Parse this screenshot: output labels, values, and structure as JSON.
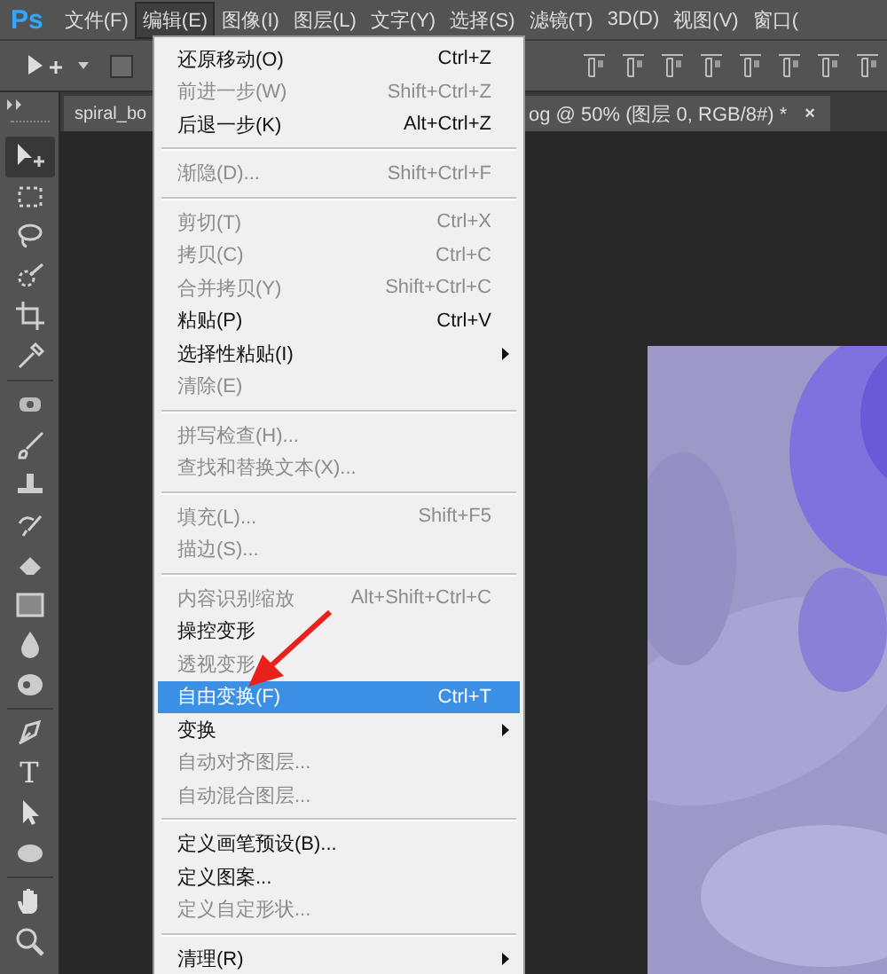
{
  "app_logo": "Ps",
  "menu_bar": [
    {
      "label": "文件(F)",
      "selected": false
    },
    {
      "label": "编辑(E)",
      "selected": true
    },
    {
      "label": "图像(I)",
      "selected": false
    },
    {
      "label": "图层(L)",
      "selected": false
    },
    {
      "label": "文字(Y)",
      "selected": false
    },
    {
      "label": "选择(S)",
      "selected": false
    },
    {
      "label": "滤镜(T)",
      "selected": false
    },
    {
      "label": "3D(D)",
      "selected": false
    },
    {
      "label": "视图(V)",
      "selected": false
    },
    {
      "label": "窗口(",
      "selected": false
    }
  ],
  "options_bar": {
    "auto_select_checked": false
  },
  "document_tab": {
    "title_start": "spiral_bo",
    "title_end": "og @ 50% (图层 0, RGB/8#) *",
    "close": "×"
  },
  "tools": [
    {
      "kind": "move",
      "selected": true
    },
    {
      "kind": "marquee",
      "selected": false
    },
    {
      "kind": "lasso",
      "selected": false
    },
    {
      "kind": "quick",
      "selected": false
    },
    {
      "kind": "crop",
      "selected": false
    },
    {
      "kind": "eyedropper",
      "selected": false,
      "group_end": true
    },
    {
      "kind": "healing",
      "selected": false
    },
    {
      "kind": "brush",
      "selected": false
    },
    {
      "kind": "stamp",
      "selected": false
    },
    {
      "kind": "history",
      "selected": false
    },
    {
      "kind": "eraser",
      "selected": false
    },
    {
      "kind": "gradient",
      "selected": false
    },
    {
      "kind": "blur",
      "selected": false
    },
    {
      "kind": "dodge",
      "selected": false,
      "group_end": true
    },
    {
      "kind": "pen",
      "selected": false
    },
    {
      "kind": "type",
      "glyph": "T",
      "selected": false
    },
    {
      "kind": "path",
      "selected": false
    },
    {
      "kind": "ellipse",
      "selected": false,
      "group_end": true
    },
    {
      "kind": "hand",
      "selected": false
    },
    {
      "kind": "zoom",
      "selected": false
    }
  ],
  "edit_menu": [
    {
      "kind": "item",
      "label": "还原移动(O)",
      "shortcut": "Ctrl+Z",
      "disabled": false,
      "submenu": false,
      "selected": false
    },
    {
      "kind": "item",
      "label": "前进一步(W)",
      "shortcut": "Shift+Ctrl+Z",
      "disabled": true,
      "submenu": false,
      "selected": false
    },
    {
      "kind": "item",
      "label": "后退一步(K)",
      "shortcut": "Alt+Ctrl+Z",
      "disabled": false,
      "submenu": false,
      "selected": false
    },
    {
      "kind": "separator"
    },
    {
      "kind": "item",
      "label": "渐隐(D)...",
      "shortcut": "Shift+Ctrl+F",
      "disabled": true,
      "submenu": false,
      "selected": false
    },
    {
      "kind": "separator"
    },
    {
      "kind": "item",
      "label": "剪切(T)",
      "shortcut": "Ctrl+X",
      "disabled": true,
      "submenu": false,
      "selected": false
    },
    {
      "kind": "item",
      "label": "拷贝(C)",
      "shortcut": "Ctrl+C",
      "disabled": true,
      "submenu": false,
      "selected": false
    },
    {
      "kind": "item",
      "label": "合并拷贝(Y)",
      "shortcut": "Shift+Ctrl+C",
      "disabled": true,
      "submenu": false,
      "selected": false
    },
    {
      "kind": "item",
      "label": "粘贴(P)",
      "shortcut": "Ctrl+V",
      "disabled": false,
      "submenu": false,
      "selected": false
    },
    {
      "kind": "item",
      "label": "选择性粘贴(I)",
      "disabled": false,
      "submenu": true,
      "selected": false
    },
    {
      "kind": "item",
      "label": "清除(E)",
      "disabled": true,
      "submenu": false,
      "selected": false
    },
    {
      "kind": "separator"
    },
    {
      "kind": "item",
      "label": "拼写检查(H)...",
      "disabled": true,
      "submenu": false,
      "selected": false
    },
    {
      "kind": "item",
      "label": "查找和替换文本(X)...",
      "disabled": true,
      "submenu": false,
      "selected": false
    },
    {
      "kind": "separator"
    },
    {
      "kind": "item",
      "label": "填充(L)...",
      "shortcut": "Shift+F5",
      "disabled": true,
      "submenu": false,
      "selected": false
    },
    {
      "kind": "item",
      "label": "描边(S)...",
      "disabled": true,
      "submenu": false,
      "selected": false
    },
    {
      "kind": "separator"
    },
    {
      "kind": "item",
      "label": "内容识别缩放",
      "shortcut": "Alt+Shift+Ctrl+C",
      "disabled": true,
      "submenu": false,
      "selected": false
    },
    {
      "kind": "item",
      "label": "操控变形",
      "disabled": false,
      "submenu": false,
      "selected": false
    },
    {
      "kind": "item",
      "label": "透视变形",
      "disabled": true,
      "submenu": false,
      "selected": false
    },
    {
      "kind": "item",
      "label": "自由变换(F)",
      "shortcut": "Ctrl+T",
      "disabled": false,
      "submenu": false,
      "selected": true
    },
    {
      "kind": "item",
      "label": "变换",
      "disabled": false,
      "submenu": true,
      "selected": false
    },
    {
      "kind": "item",
      "label": "自动对齐图层...",
      "disabled": true,
      "submenu": false,
      "selected": false
    },
    {
      "kind": "item",
      "label": "自动混合图层...",
      "disabled": true,
      "submenu": false,
      "selected": false
    },
    {
      "kind": "separator"
    },
    {
      "kind": "item",
      "label": "定义画笔预设(B)...",
      "disabled": false,
      "submenu": false,
      "selected": false
    },
    {
      "kind": "item",
      "label": "定义图案...",
      "disabled": false,
      "submenu": false,
      "selected": false
    },
    {
      "kind": "item",
      "label": "定义自定形状...",
      "disabled": true,
      "submenu": false,
      "selected": false
    },
    {
      "kind": "separator"
    },
    {
      "kind": "item",
      "label": "清理(R)",
      "disabled": false,
      "submenu": true,
      "selected": false
    }
  ]
}
